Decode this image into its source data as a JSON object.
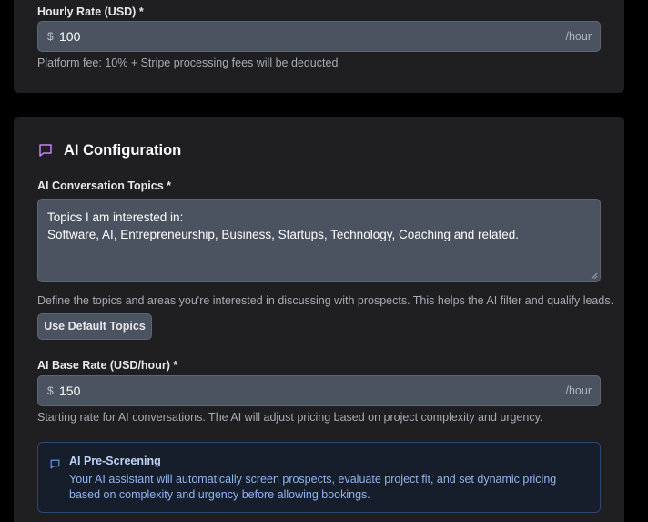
{
  "hourly_rate": {
    "label": "Hourly Rate (USD) *",
    "currency_symbol": "$",
    "value": "100",
    "suffix": "/hour",
    "help": "Platform fee: 10% + Stripe processing fees will be deducted"
  },
  "ai_configuration": {
    "title": "AI Configuration",
    "icon": "chat-bubble-icon",
    "accent_color": "#c084fc",
    "topics": {
      "label": "AI Conversation Topics *",
      "value_lines": [
        "Topics I am interested in:",
        "Software, AI, Entrepreneurship, Business, Startups, Technology, Coaching and related."
      ],
      "help": "Define the topics and areas you're interested in discussing with prospects. This helps the AI filter and qualify leads.",
      "default_button_label": "Use Default Topics"
    },
    "base_rate": {
      "label": "AI Base Rate (USD/hour) *",
      "currency_symbol": "$",
      "value": "150",
      "suffix": "/hour",
      "help": "Starting rate for AI conversations. The AI will adjust pricing based on project complexity and urgency."
    },
    "pre_screening": {
      "icon": "chat-bubble-icon",
      "title": "AI Pre-Screening",
      "body": "Your AI assistant will automatically screen prospects, evaluate project fit, and set dynamic pricing based on complexity and urgency before allowing bookings.",
      "accent_color": "#60a5fa"
    }
  }
}
